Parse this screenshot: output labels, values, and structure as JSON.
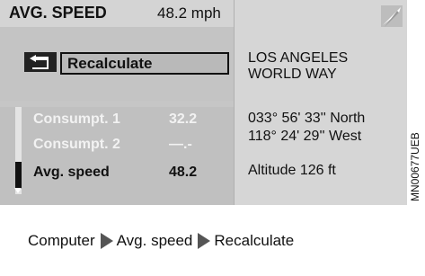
{
  "header": {
    "label": "AVG. SPEED",
    "value": "48.2 mph"
  },
  "action": {
    "recalculate_label": "Recalculate"
  },
  "list": [
    {
      "name": "Consumpt. 1",
      "value": "32.2",
      "state": "dim"
    },
    {
      "name": "Consumpt. 2",
      "value": "—.-",
      "state": "dim"
    },
    {
      "name": "Avg. speed",
      "value": "48.2",
      "state": "selected"
    }
  ],
  "destination": {
    "line1": "LOS ANGELES",
    "line2": "WORLD WAY"
  },
  "position": {
    "lat": "033° 56' 33'' North",
    "lon": "118° 24' 29'' West",
    "altitude": "Altitude 126 ft"
  },
  "side_code": "MN00677UEB",
  "caption": {
    "part1": "Computer",
    "part2": "Avg. speed",
    "part3": "Recalculate"
  },
  "icons": {
    "back": "back-arrow-icon",
    "compass": "compass-icon",
    "triangle": "triangle-right-icon"
  },
  "colors": {
    "panel": "#c6c6c6",
    "text": "#111111",
    "dim_text": "#f2f2f2"
  }
}
